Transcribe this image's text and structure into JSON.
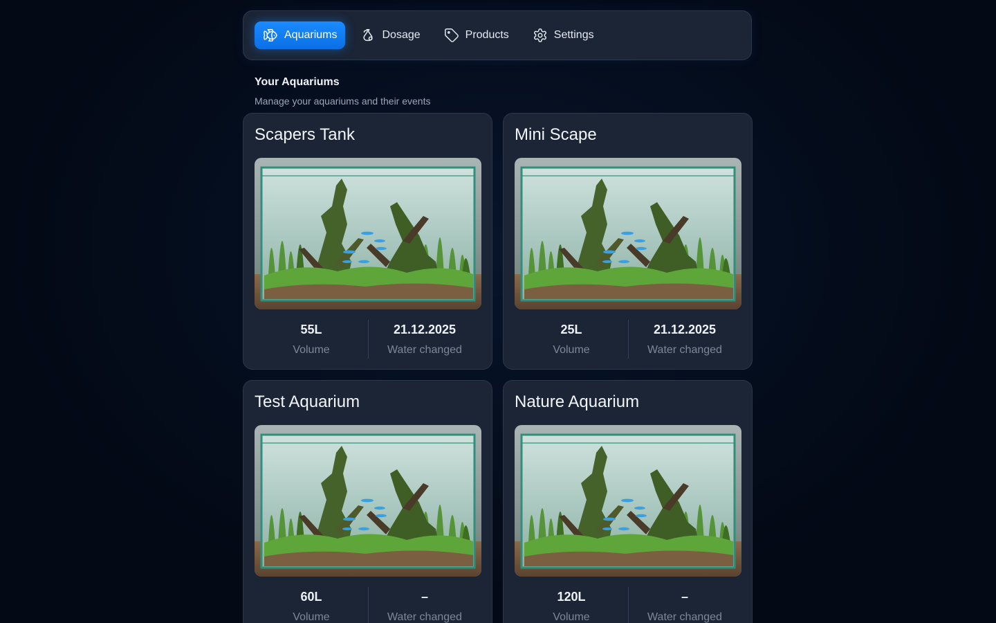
{
  "nav": {
    "items": [
      {
        "label": "Aquariums",
        "icon": "fish-icon",
        "active": true
      },
      {
        "label": "Dosage",
        "icon": "flask-icon",
        "active": false
      },
      {
        "label": "Products",
        "icon": "tag-icon",
        "active": false
      },
      {
        "label": "Settings",
        "icon": "gear-icon",
        "active": false
      }
    ]
  },
  "section": {
    "title": "Your Aquariums",
    "subtitle": "Manage your aquariums and their events"
  },
  "aquariums": [
    {
      "name": "Scapers Tank",
      "volume": "55L",
      "volume_label": "Volume",
      "water_changed": "21.12.2025",
      "water_changed_label": "Water changed"
    },
    {
      "name": "Mini Scape",
      "volume": "25L",
      "volume_label": "Volume",
      "water_changed": "21.12.2025",
      "water_changed_label": "Water changed"
    },
    {
      "name": "Test Aquarium",
      "volume": "60L",
      "volume_label": "Volume",
      "water_changed": "–",
      "water_changed_label": "Water changed"
    },
    {
      "name": "Nature Aquarium",
      "volume": "120L",
      "volume_label": "Volume",
      "water_changed": "–",
      "water_changed_label": "Water changed"
    }
  ],
  "colors": {
    "accent": "#1a8cff",
    "background": "#030b1a",
    "card": "#1b2536"
  }
}
